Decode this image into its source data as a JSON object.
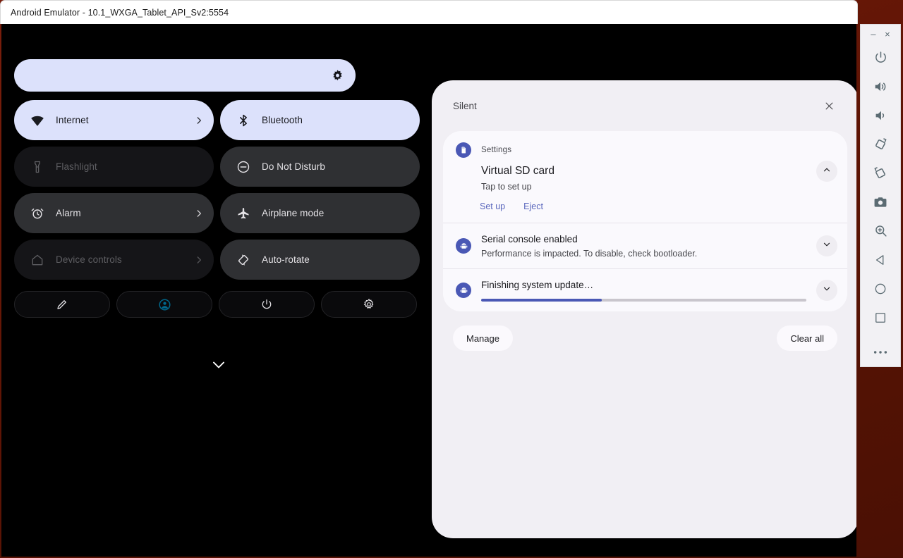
{
  "window": {
    "title": "Android Emulator - 10.1_WXGA_Tablet_API_Sv2:5554"
  },
  "quick_settings": {
    "brightness": {
      "icon": "brightness-sun-icon",
      "fill_percent": 87
    },
    "tiles": [
      {
        "label": "Internet",
        "icon": "wifi-icon",
        "state": "on",
        "chevron": true
      },
      {
        "label": "Bluetooth",
        "icon": "bluetooth-icon",
        "state": "on",
        "chevron": false
      },
      {
        "label": "Flashlight",
        "icon": "flashlight-icon",
        "state": "disabled",
        "chevron": false
      },
      {
        "label": "Do Not Disturb",
        "icon": "do-not-disturb-icon",
        "state": "off",
        "chevron": false
      },
      {
        "label": "Alarm",
        "icon": "alarm-icon",
        "state": "off",
        "chevron": true
      },
      {
        "label": "Airplane mode",
        "icon": "airplane-icon",
        "state": "off",
        "chevron": false
      },
      {
        "label": "Device controls",
        "icon": "home-icon",
        "state": "disabled",
        "chevron": true
      },
      {
        "label": "Auto-rotate",
        "icon": "auto-rotate-icon",
        "state": "off",
        "chevron": false
      }
    ],
    "footer_buttons": [
      {
        "name": "edit-tiles-button",
        "icon": "pencil-icon"
      },
      {
        "name": "user-switch-button",
        "icon": "user-avatar-icon"
      },
      {
        "name": "power-menu-button",
        "icon": "power-icon"
      },
      {
        "name": "settings-button",
        "icon": "gear-icon"
      }
    ],
    "expand_handle_icon": "chevron-down-icon"
  },
  "shade": {
    "section_label": "Silent",
    "close_icon": "close-icon",
    "notifications": [
      {
        "type": "expanded",
        "app_name": "Settings",
        "app_icon": "sd-card-icon",
        "title": "Virtual SD card",
        "subtitle": "Tap to set up",
        "expander_icon": "chevron-up-icon",
        "actions": [
          {
            "label": "Set up"
          },
          {
            "label": "Eject"
          }
        ]
      },
      {
        "type": "compact",
        "app_icon": "android-head-icon",
        "title": "Serial console enabled",
        "detail": "Performance is impacted. To disable, check bootloader.",
        "expander_icon": "chevron-down-icon"
      },
      {
        "type": "progress",
        "app_icon": "android-head-icon",
        "title": "Finishing system update…",
        "progress_percent": 37,
        "expander_icon": "chevron-down-icon"
      }
    ],
    "manage_label": "Manage",
    "clear_all_label": "Clear all"
  },
  "toolbar": {
    "minimize_label": "–",
    "close_label": "×",
    "buttons": [
      {
        "name": "power-button",
        "icon": "power-icon"
      },
      {
        "name": "volume-up-button",
        "icon": "volume-up-icon"
      },
      {
        "name": "volume-down-button",
        "icon": "volume-down-icon"
      },
      {
        "name": "rotate-left-button",
        "icon": "rotate-left-icon"
      },
      {
        "name": "rotate-right-button",
        "icon": "rotate-right-icon"
      },
      {
        "name": "screenshot-button",
        "icon": "camera-icon"
      },
      {
        "name": "zoom-button",
        "icon": "magnifier-plus-icon"
      },
      {
        "name": "back-button",
        "icon": "triangle-back-icon"
      },
      {
        "name": "home-button",
        "icon": "circle-home-icon"
      },
      {
        "name": "overview-button",
        "icon": "square-overview-icon"
      },
      {
        "name": "more-button",
        "icon": "ellipsis-icon"
      }
    ]
  },
  "colors": {
    "tile_on": "#dce1fb",
    "tile_off": "#2f3033",
    "shade_bg": "#f1eff4",
    "notif_bg": "#faf9fd",
    "accent_blue": "#4a58b5",
    "link_blue": "#5a67bd",
    "avatar_teal": "#00688c",
    "desktop": "#601505"
  }
}
